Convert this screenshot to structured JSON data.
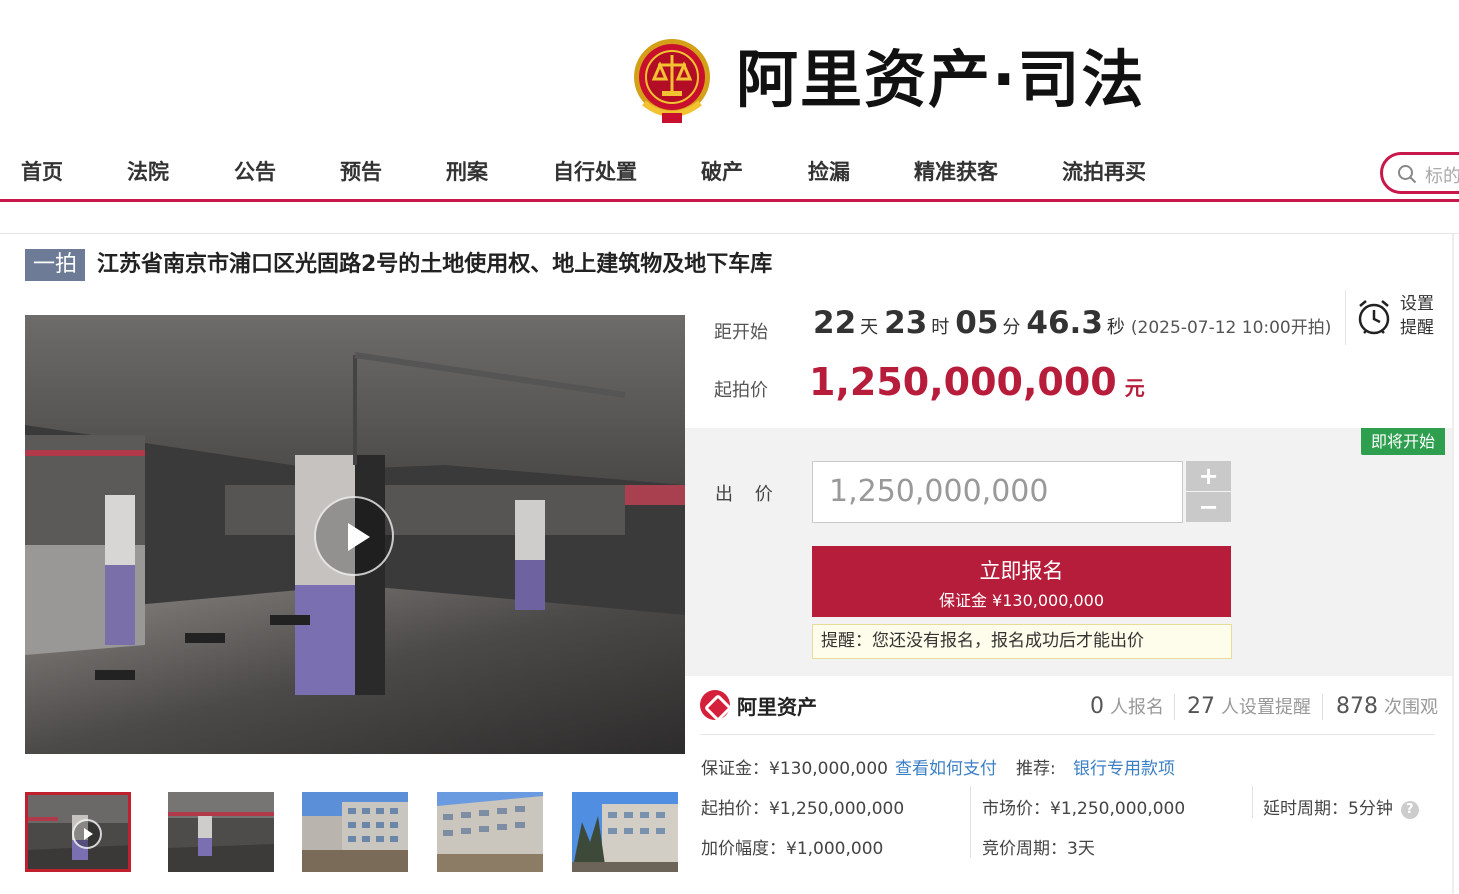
{
  "header": {
    "logo_text": "阿里资产·司法"
  },
  "nav": {
    "items": [
      "首页",
      "法院",
      "公告",
      "预告",
      "刑案",
      "自行处置",
      "破产",
      "捡漏",
      "精准获客",
      "流拍再买"
    ],
    "search_placeholder": "标的"
  },
  "item": {
    "round_badge": "一拍",
    "title": "江苏省南京市浦口区光固路2号的土地使用权、地上建筑物及地下车库"
  },
  "countdown": {
    "label": "距开始",
    "days": "22",
    "days_unit": "天",
    "hours": "23",
    "hours_unit": "时",
    "minutes": "05",
    "minutes_unit": "分",
    "seconds": "46.3",
    "seconds_unit": "秒",
    "start_time": "(2025-07-12 10:00开拍)"
  },
  "reminder": {
    "label": "设置提醒"
  },
  "start_price": {
    "label": "起拍价",
    "amount": "1,250,000,000",
    "unit": "元"
  },
  "bid": {
    "status_badge": "即将开始",
    "label": "出 价",
    "input_value": "1,250,000,000",
    "plus": "+",
    "minus": "−",
    "register_label": "立即报名",
    "deposit_label": "保证金 ¥130,000,000",
    "hint": "提醒：您还没有报名，报名成功后才能出价"
  },
  "platform": {
    "name": "阿里资产"
  },
  "stats": [
    {
      "count": "0",
      "label": "人报名"
    },
    {
      "count": "27",
      "label": "人设置提醒"
    },
    {
      "count": "878",
      "label": "次围观"
    }
  ],
  "info": {
    "deposit": "保证金：¥130,000,000",
    "how_to_pay": "查看如何支付",
    "recommend_label": "推荐:",
    "bank_loan": "银行专用款项",
    "start_price": "起拍价：¥1,250,000,000",
    "market_price": "市场价：¥1,250,000,000",
    "delay_period": "延时周期：5分钟",
    "increment": "加价幅度：¥1,000,000",
    "auction_period": "竞价周期：3天"
  },
  "colors": {
    "brand_red": "#c8174b",
    "price_red": "#b81c3b",
    "button_red": "#b61d3a",
    "badge_green": "#2e9e4f",
    "link_blue": "#3b7fc4"
  }
}
